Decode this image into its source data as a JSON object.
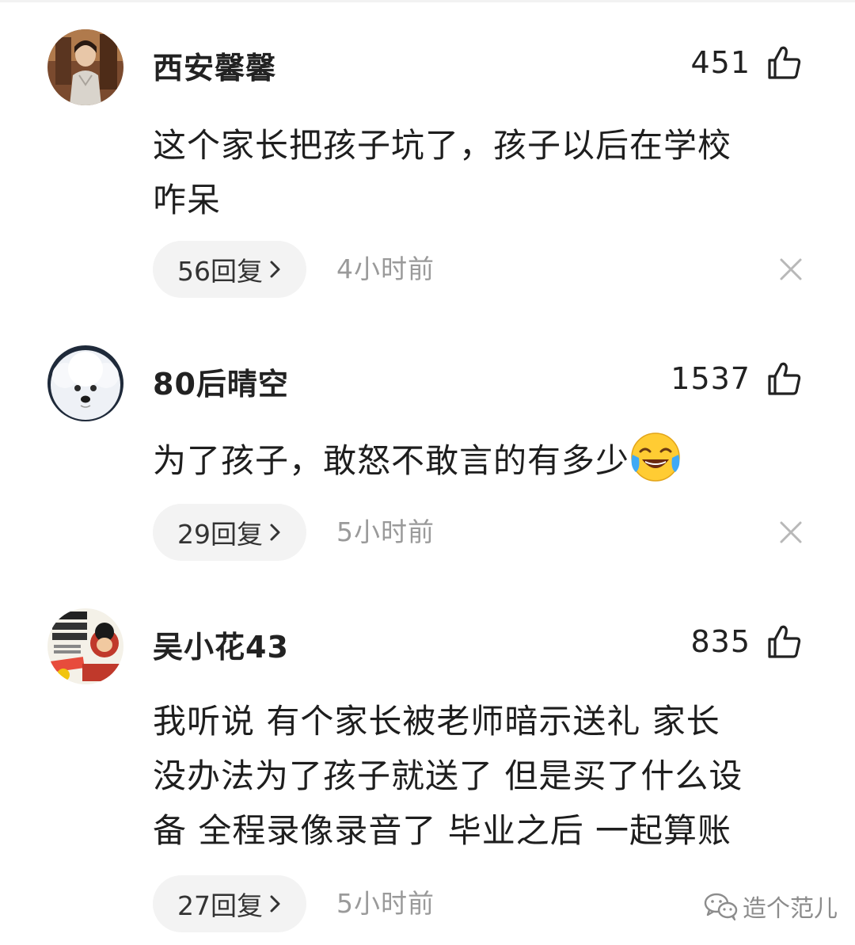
{
  "comments": [
    {
      "username": "西安馨馨",
      "likes": "451",
      "lines": [
        "这个家长把孩子坑了，孩子以后在学校",
        "咋呆"
      ],
      "replies": "56回复",
      "time": "4小时前",
      "avatar": "woman-portrait-avatar"
    },
    {
      "username": "80后晴空",
      "likes": "1537",
      "lines": [
        "为了孩子，敢怒不敢言的有多少"
      ],
      "emoji": "crying-laughing-emoji",
      "replies": "29回复",
      "time": "5小时前",
      "avatar": "white-dog-avatar"
    },
    {
      "username": "吴小花43",
      "likes": "835",
      "lines": [
        "我听说 有个家长被老师暗示送礼 家长",
        "没办法为了孩子就送了 但是买了什么设",
        "备 全程录像录音了 毕业之后 一起算账"
      ],
      "replies": "27回复",
      "time": "5小时前",
      "avatar": "book-cover-avatar"
    }
  ],
  "watermark": {
    "text": "造个范儿",
    "icon": "wechat-icon"
  },
  "colors": {
    "pill_bg": "#f3f3f3",
    "time_gray": "#9a9a9a",
    "text": "#222222"
  },
  "icons": {
    "like": "thumbs-up-icon",
    "chevron": "chevron-right-icon",
    "dismiss": "close-icon"
  }
}
